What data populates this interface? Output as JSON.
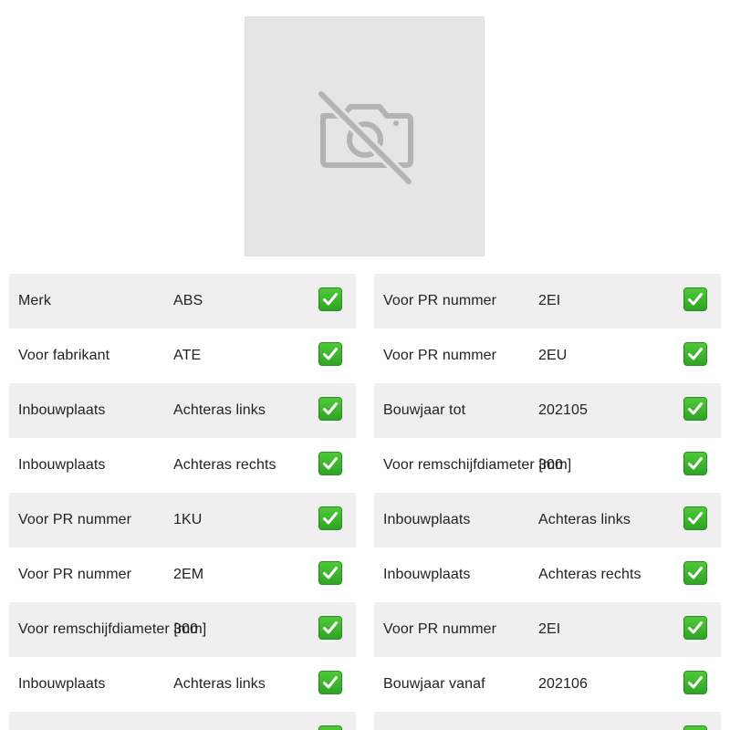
{
  "image": {
    "icon": "no-image-camera-icon",
    "background": "#e5e5e5",
    "icon_color": "#b3b3b3"
  },
  "check_color": "#38b12b",
  "left_rows": [
    {
      "label": "Merk",
      "value": "ABS",
      "icon": "check-icon"
    },
    {
      "label": "Voor fabrikant",
      "value": "ATE",
      "icon": "check-icon"
    },
    {
      "label": "Inbouwplaats",
      "value": "Achteras links",
      "icon": "check-icon"
    },
    {
      "label": "Inbouwplaats",
      "value": "Achteras rechts",
      "icon": "check-icon"
    },
    {
      "label": "Voor PR nummer",
      "value": "1KU",
      "icon": "check-icon"
    },
    {
      "label": "Voor PR nummer",
      "value": "2EM",
      "icon": "check-icon"
    },
    {
      "label": "Voor remschijfdiameter [mm]",
      "value": "300",
      "icon": "check-icon"
    },
    {
      "label": "Inbouwplaats",
      "value": "Achteras links",
      "icon": "check-icon"
    },
    {
      "label": "",
      "value": "",
      "icon": "check-icon"
    }
  ],
  "right_rows": [
    {
      "label": "Voor PR nummer",
      "value": "2EI",
      "icon": "check-icon"
    },
    {
      "label": "Voor PR nummer",
      "value": "2EU",
      "icon": "check-icon"
    },
    {
      "label": "Bouwjaar tot",
      "value": "202105",
      "icon": "check-icon"
    },
    {
      "label": "Voor remschijfdiameter [mm]",
      "value": "300",
      "icon": "check-icon"
    },
    {
      "label": "Inbouwplaats",
      "value": "Achteras links",
      "icon": "check-icon"
    },
    {
      "label": "Inbouwplaats",
      "value": "Achteras rechts",
      "icon": "check-icon"
    },
    {
      "label": "Voor PR nummer",
      "value": "2EI",
      "icon": "check-icon"
    },
    {
      "label": "Bouwjaar vanaf",
      "value": "202106",
      "icon": "check-icon"
    },
    {
      "label": "",
      "value": "",
      "icon": "check-icon"
    }
  ]
}
